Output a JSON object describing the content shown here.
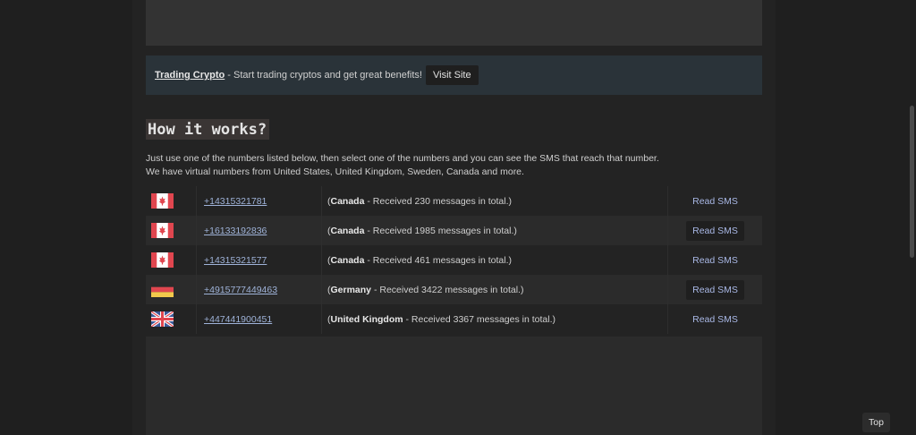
{
  "banner": {
    "brand": "Trading Crypto",
    "separator": " - ",
    "text": "Start trading cryptos and get great benefits!",
    "button": "Visit Site"
  },
  "section_title": "How it works?",
  "intro": {
    "line1": "Just use one of the numbers listed below, then select one of the numbers and you can see the SMS that reach that number.",
    "line2": "We have virtual numbers from United States, United Kingdom, Sweden, Canada and more."
  },
  "numbers": [
    {
      "flag": "canada-flag-icon",
      "number": "+14315321781",
      "country": "Canada",
      "summary": " - Received 230 messages in total.)",
      "action": "Read SMS"
    },
    {
      "flag": "canada-flag-icon",
      "number": "+16133192836",
      "country": "Canada",
      "summary": " - Received 1985 messages in total.)",
      "action": "Read SMS"
    },
    {
      "flag": "canada-flag-icon",
      "number": "+14315321577",
      "country": "Canada",
      "summary": " - Received 461 messages in total.)",
      "action": "Read SMS"
    },
    {
      "flag": "germany-flag-icon",
      "number": "+4915777449463",
      "country": "Germany",
      "summary": " - Received 3422 messages in total.)",
      "action": "Read SMS"
    },
    {
      "flag": "uk-flag-icon",
      "number": "+447441900451",
      "country": "United Kingdom",
      "summary": " - Received 3367 messages in total.)",
      "action": "Read SMS"
    }
  ],
  "paren_open": "(",
  "top_button": "Top"
}
